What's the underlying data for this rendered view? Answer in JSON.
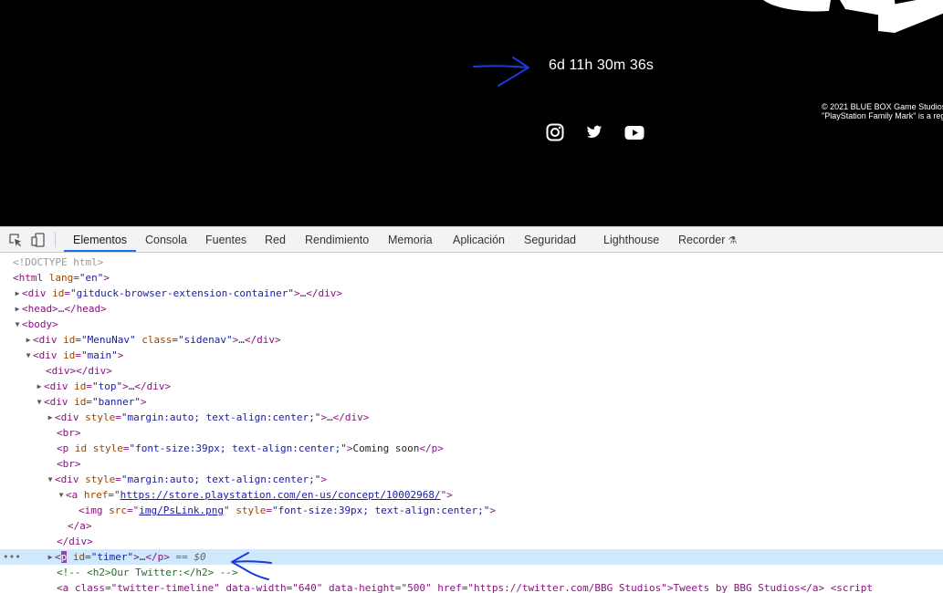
{
  "viewport": {
    "countdown": "6d 11h 30m 36s",
    "copyright_line1": "© 2021 BLUE BOX Game Studios",
    "copyright_line2": "\"PlayStation Family Mark\" is a reg",
    "social_icons": [
      "instagram-icon",
      "twitter-icon",
      "youtube-icon"
    ]
  },
  "devtools": {
    "tabs": [
      "Elementos",
      "Consola",
      "Fuentes",
      "Red",
      "Rendimiento",
      "Memoria",
      "Aplicación",
      "Seguridad",
      "Lighthouse",
      "Recorder"
    ],
    "active_tab": "Elementos",
    "tree": {
      "doctype": "<!DOCTYPE html>",
      "html_open": "<html ",
      "lang_attr": "lang",
      "lang_val": "\"en\"",
      "gitduck_id": "\"gitduck-browser-extension-container\"",
      "head": "<head>…</head>",
      "body": "<body>",
      "menunav_id": "\"MenuNav\"",
      "menunav_class": "\"sidenav\"",
      "main_id": "\"main\"",
      "empty_div": "<div></div>",
      "top_id": "\"top\"",
      "banner_id": "\"banner\"",
      "style_center": "\"margin:auto; text-align:center;\"",
      "br": "<br>",
      "p_style": "\"font-size:39px; text-align:center;\"",
      "coming_soon": "Coming soon",
      "href": "https://store.playstation.com/en-us/concept/10002968/",
      "img_src": "img/PsLink.png",
      "img_style": "\"font-size:39px; text-align:center;\"",
      "a_close": "</a>",
      "div_close": "</div>",
      "timer_id": "\"timer\"",
      "eq_dollar": "== $0",
      "comment": "<!-- <h2>Our Twitter:</h2> -->",
      "last_line": "<a class=\"twitter-timeline\" data-width=\"640\" data-height=\"500\" href=\"https://twitter.com/BBG_Studios\">Tweets by BBG_Studios</a> <script"
    }
  }
}
